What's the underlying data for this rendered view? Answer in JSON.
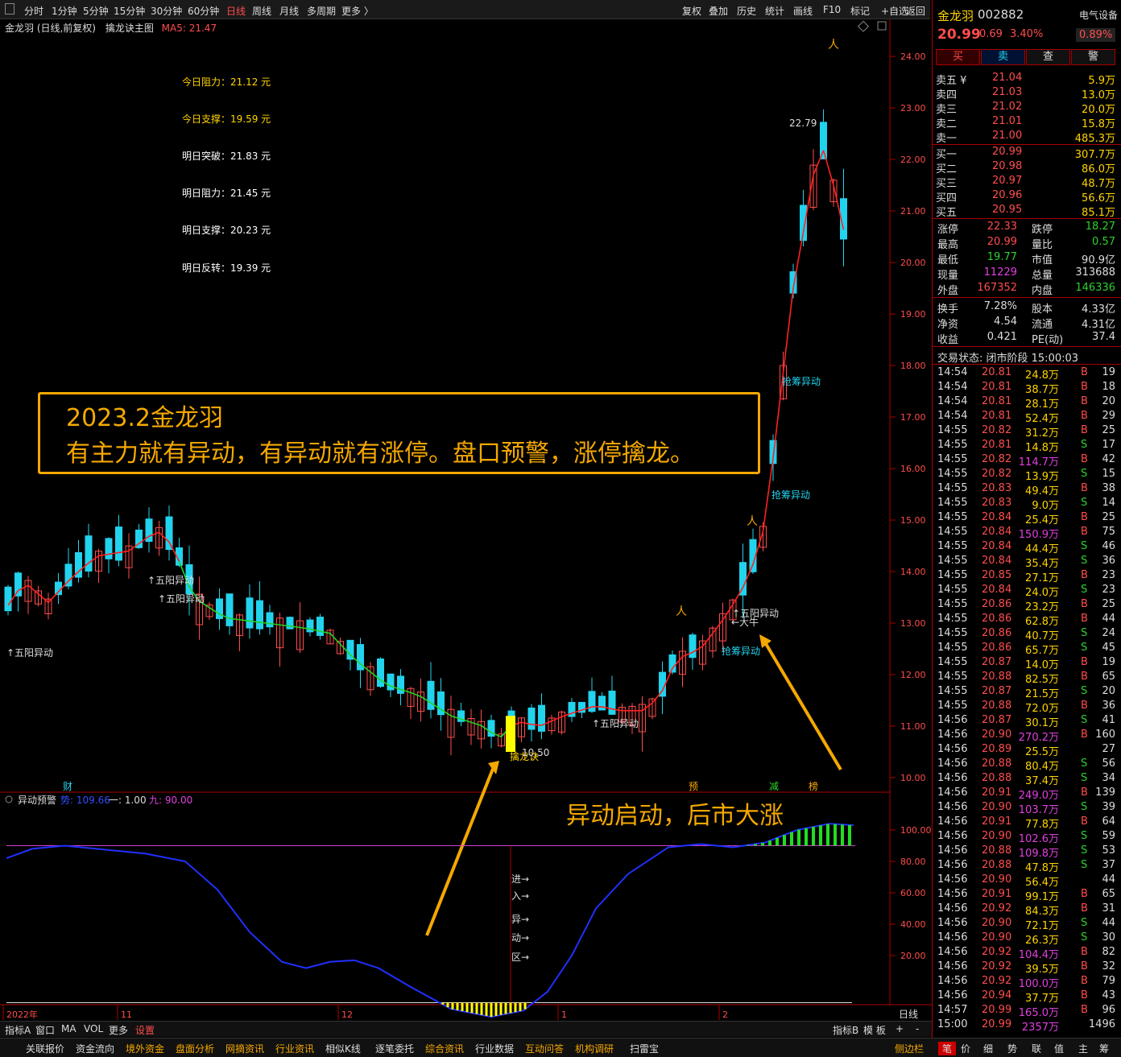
{
  "toolbar": {
    "periods": [
      "分时",
      "1分钟",
      "5分钟",
      "15分钟",
      "30分钟",
      "60分钟",
      "日线",
      "周线",
      "月线",
      "多周期",
      "更多 〉"
    ],
    "right": [
      "复权",
      "叠加",
      "历史",
      "统计",
      "画线",
      "F10",
      "标记",
      "+自选",
      "返回"
    ]
  },
  "chart_title": {
    "name": "金龙羽 (日线,前复权)",
    "indicator": "擒龙诀主图",
    "ma": "MA5: 21.47"
  },
  "levels": [
    {
      "label": "今日阻力：21.12 元",
      "color": "#ffd400"
    },
    {
      "label": "今日支撑：19.59 元",
      "color": "#ffd400"
    },
    {
      "label": "明日突破：21.83 元",
      "color": "#ffffff"
    },
    {
      "label": "明日阻力：21.45 元",
      "color": "#ffffff"
    },
    {
      "label": "明日支撑：20.23 元",
      "color": "#ffffff"
    },
    {
      "label": "明日反转：19.39 元",
      "color": "#ffffff"
    }
  ],
  "price_axis": [
    "24.00",
    "23.00",
    "22.00",
    "21.00",
    "20.00",
    "19.00",
    "18.00",
    "17.00",
    "16.00",
    "15.00",
    "14.00",
    "13.00",
    "12.00",
    "11.00",
    "10.00"
  ],
  "annot": {
    "line1": "2023.2金龙羽",
    "line2": "有主力就有异动，有异动就有涨停。盘口预警，涨停擒龙。",
    "arrow_text": "异动启动，后市大涨"
  },
  "chart_labels": {
    "wuyang": "↑五阳异动",
    "qiangchou": "抢筹异动",
    "qinlong": "擒龙诀",
    "low": "10.50",
    "high": "22.79",
    "daniu": "←大牛",
    "cai": "财",
    "yu": "预",
    "jian": "减",
    "bang": "榜"
  },
  "sub": {
    "title": "异动预警",
    "s1": "势: 109.66",
    "s2": "一: 1.00",
    "s3": "九: 90.00",
    "axis": [
      "100.00",
      "80.00",
      "60.00",
      "40.00",
      "20.00"
    ],
    "zone": [
      "进→",
      "入→",
      "异→",
      "动→",
      "区→"
    ]
  },
  "date_axis": [
    "2022年",
    "11",
    "12",
    "1",
    "2"
  ],
  "day_label": "日线",
  "bottom": {
    "left": [
      "指标A",
      "窗口",
      "MA",
      "VOL",
      "更多",
      "设置"
    ],
    "right": [
      "指标B",
      "模 板",
      "+",
      "-"
    ]
  },
  "footer": {
    "items": [
      "关联报价",
      "资金流向",
      "境外资金",
      "盘面分析",
      "网摘资讯",
      "行业资讯",
      "相似K线",
      "逐笔委托",
      "综合资讯",
      "行业数据",
      "互动问答",
      "机构调研",
      "扫雷宝"
    ],
    "right": [
      "侧边栏",
      "笔",
      "价",
      "细",
      "势",
      "联",
      "值",
      "主",
      "筹"
    ]
  },
  "quote": {
    "name": "金龙羽",
    "code": "002882",
    "sector": "电气设备",
    "price": "20.99",
    "chg": "0.69",
    "pct": "3.40%",
    "sector_pct": "0.89%",
    "buttons": [
      "买",
      "卖",
      "查",
      "警"
    ]
  },
  "asks": [
    [
      "卖五 ¥",
      "21.04",
      "5.9万"
    ],
    [
      "卖四",
      "21.03",
      "13.0万"
    ],
    [
      "卖三",
      "21.02",
      "20.0万"
    ],
    [
      "卖二",
      "21.01",
      "15.8万"
    ],
    [
      "卖一",
      "21.00",
      "485.3万"
    ]
  ],
  "bids": [
    [
      "买一",
      "20.99",
      "307.7万"
    ],
    [
      "买二",
      "20.98",
      "86.0万"
    ],
    [
      "买三",
      "20.97",
      "48.7万"
    ],
    [
      "买四",
      "20.96",
      "56.6万"
    ],
    [
      "买五",
      "20.95",
      "85.1万"
    ]
  ],
  "stats": [
    [
      "涨停",
      "22.33",
      "跌停",
      "18.27"
    ],
    [
      "最高",
      "20.99",
      "量比",
      "0.57"
    ],
    [
      "最低",
      "19.77",
      "市值",
      "90.9亿"
    ],
    [
      "现量",
      "11229",
      "总量",
      "313688"
    ],
    [
      "外盘",
      "167352",
      "内盘",
      "146336"
    ]
  ],
  "stats2": [
    [
      "换手",
      "7.28%",
      "股本",
      "4.33亿"
    ],
    [
      "净资",
      "4.54",
      "流通",
      "4.31亿"
    ],
    [
      "收益",
      "0.421",
      "PE(动)",
      "37.4"
    ]
  ],
  "trade_state": "交易状态: 闭市阶段 15:00:03",
  "ticks": [
    [
      "14:54",
      "20.81",
      "24.8万",
      "B",
      "19"
    ],
    [
      "14:54",
      "20.81",
      "38.7万",
      "B",
      "18"
    ],
    [
      "14:54",
      "20.81",
      "28.1万",
      "B",
      "20"
    ],
    [
      "14:54",
      "20.81",
      "52.4万",
      "B",
      "29"
    ],
    [
      "14:55",
      "20.82",
      "31.2万",
      "B",
      "25"
    ],
    [
      "14:55",
      "20.81",
      "14.8万",
      "S",
      "17"
    ],
    [
      "14:55",
      "20.82",
      "114.7万",
      "B",
      "42"
    ],
    [
      "14:55",
      "20.82",
      "13.9万",
      "S",
      "15"
    ],
    [
      "14:55",
      "20.83",
      "49.4万",
      "B",
      "38"
    ],
    [
      "14:55",
      "20.83",
      "9.0万",
      "S",
      "14"
    ],
    [
      "14:55",
      "20.84",
      "25.4万",
      "B",
      "25"
    ],
    [
      "14:55",
      "20.84",
      "150.9万",
      "B",
      "75"
    ],
    [
      "14:55",
      "20.84",
      "44.4万",
      "S",
      "46"
    ],
    [
      "14:55",
      "20.84",
      "35.4万",
      "S",
      "36"
    ],
    [
      "14:55",
      "20.85",
      "27.1万",
      "B",
      "23"
    ],
    [
      "14:55",
      "20.84",
      "24.0万",
      "S",
      "23"
    ],
    [
      "14:55",
      "20.86",
      "23.2万",
      "B",
      "25"
    ],
    [
      "14:55",
      "20.86",
      "62.8万",
      "B",
      "44"
    ],
    [
      "14:55",
      "20.86",
      "40.7万",
      "S",
      "24"
    ],
    [
      "14:55",
      "20.86",
      "65.7万",
      "S",
      "45"
    ],
    [
      "14:55",
      "20.87",
      "14.0万",
      "B",
      "19"
    ],
    [
      "14:55",
      "20.88",
      "82.5万",
      "B",
      "65"
    ],
    [
      "14:55",
      "20.87",
      "21.5万",
      "S",
      "20"
    ],
    [
      "14:55",
      "20.88",
      "72.0万",
      "B",
      "36"
    ],
    [
      "14:56",
      "20.87",
      "30.1万",
      "S",
      "41"
    ],
    [
      "14:56",
      "20.90",
      "270.2万",
      "B",
      "160"
    ],
    [
      "14:56",
      "20.89",
      "25.5万",
      "",
      "27"
    ],
    [
      "14:56",
      "20.88",
      "80.4万",
      "S",
      "56"
    ],
    [
      "14:56",
      "20.88",
      "37.4万",
      "S",
      "34"
    ],
    [
      "14:56",
      "20.91",
      "249.0万",
      "B",
      "139"
    ],
    [
      "14:56",
      "20.90",
      "103.7万",
      "S",
      "39"
    ],
    [
      "14:56",
      "20.91",
      "77.8万",
      "B",
      "64"
    ],
    [
      "14:56",
      "20.90",
      "102.6万",
      "S",
      "59"
    ],
    [
      "14:56",
      "20.88",
      "109.8万",
      "S",
      "53"
    ],
    [
      "14:56",
      "20.88",
      "47.8万",
      "S",
      "37"
    ],
    [
      "14:56",
      "20.90",
      "56.4万",
      "",
      "44"
    ],
    [
      "14:56",
      "20.91",
      "99.1万",
      "B",
      "65"
    ],
    [
      "14:56",
      "20.92",
      "84.3万",
      "B",
      "31"
    ],
    [
      "14:56",
      "20.90",
      "72.1万",
      "S",
      "44"
    ],
    [
      "14:56",
      "20.90",
      "26.3万",
      "S",
      "30"
    ],
    [
      "14:56",
      "20.92",
      "104.4万",
      "B",
      "82"
    ],
    [
      "14:56",
      "20.92",
      "39.5万",
      "B",
      "32"
    ],
    [
      "14:56",
      "20.92",
      "100.0万",
      "B",
      "79"
    ],
    [
      "14:56",
      "20.94",
      "37.7万",
      "B",
      "43"
    ],
    [
      "14:57",
      "20.99",
      "165.0万",
      "B",
      "96"
    ],
    [
      "15:00",
      "20.99",
      "2357万",
      "",
      "1496"
    ]
  ]
}
